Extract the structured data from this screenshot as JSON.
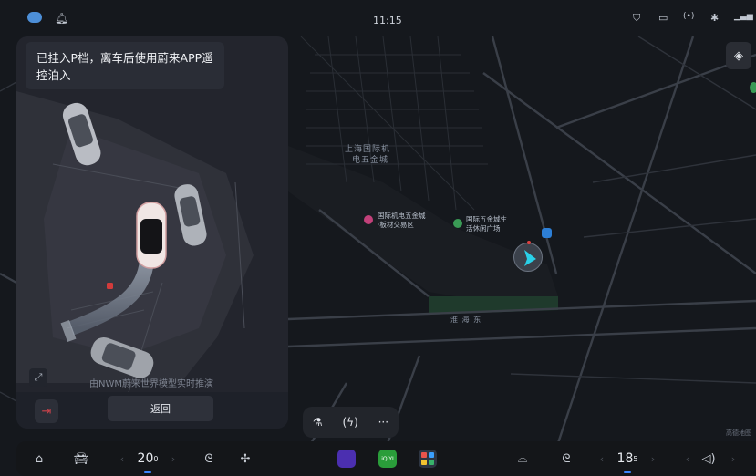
{
  "status": {
    "time": "11:15",
    "icons": [
      "car-status-icon",
      "bell-icon",
      "shield-icon",
      "dashcam-icon",
      "signal-broadcast-icon",
      "bluetooth-icon",
      "cellular-5g-icon"
    ]
  },
  "parking_panel": {
    "notice": "已挂入P档，离车后使用蔚来APP遥控泊入",
    "model_note": "由NWM蔚来世界模型实时推演",
    "back_label": "返回"
  },
  "map": {
    "area_label_line1": "上海国际机",
    "area_label_line2": "电五金城",
    "poi1_line1": "国际机电五金城",
    "poi1_line2": "·板材交易区",
    "poi2_line1": "国际五金城生",
    "poi2_line2": "活休闲广场",
    "road_label": "淮 海 东",
    "brand": "高德地图"
  },
  "quick_bar": {
    "icons": [
      "flask-icon",
      "charging-icon",
      "more-icon"
    ],
    "more_label": "···"
  },
  "dock": {
    "left_temp": "20",
    "left_temp_decimal": "0",
    "right_temp": "18",
    "right_temp_decimal": "5",
    "icons": [
      "home-icon",
      "car-icon",
      "seat-heat-left-icon",
      "fan-icon",
      "music-app-icon",
      "iqiyi-app-icon",
      "app-grid-icon",
      "defrost-icon",
      "seat-heat-right-icon",
      "volume-icon"
    ],
    "iqiyi_label": "iQIYI",
    "accent": "#3a86ff"
  }
}
